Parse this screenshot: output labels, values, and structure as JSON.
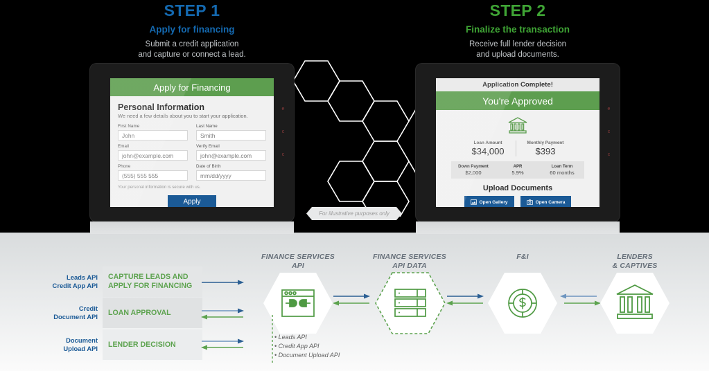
{
  "colors": {
    "blue": "#1469b0",
    "green": "#3fa535",
    "header_green": "#5d9e4f",
    "button_blue": "#1b5a96",
    "gray_text": "#67707a"
  },
  "steps": {
    "left": {
      "title": "STEP 1",
      "subtitle": "Apply for financing",
      "description_line1": "Submit a credit application",
      "description_line2": "and capture or connect a lead."
    },
    "right": {
      "title": "STEP 2",
      "subtitle": "Finalize the transaction",
      "description_line1": "Receive full lender decision",
      "description_line2": "and upload documents."
    }
  },
  "form_screen": {
    "header": "Apply for Financing",
    "section_title": "Personal Information",
    "section_note": "We need a few details about you to start your application.",
    "fields": [
      {
        "label": "First Name",
        "value": "John"
      },
      {
        "label": "Last Name",
        "value": "Smith"
      },
      {
        "label": "Email",
        "value": "john@example.com"
      },
      {
        "label": "Verify Email",
        "value": "john@example.com"
      },
      {
        "label": "Phone",
        "value": "(555) 555 555"
      },
      {
        "label": "Date of Birth",
        "value": "mm/dd/yyyy"
      }
    ],
    "secure_note": "Your personal information is secure with us.",
    "submit_label": "Apply"
  },
  "approved_screen": {
    "status_bar": "Application Complete!",
    "banner": "You're Approved",
    "bank_icon": "bank-icon",
    "summary": [
      {
        "caption": "Loan Amount",
        "value": "$34,000"
      },
      {
        "caption": "Monthly Payment",
        "value": "$393"
      }
    ],
    "terms": [
      {
        "caption": "Down Payment",
        "value": "$2,000"
      },
      {
        "caption": "APR",
        "value": "5.9%"
      },
      {
        "caption": "Loan Term",
        "value": "60 months"
      }
    ],
    "upload_title": "Upload Documents",
    "upload_buttons": [
      {
        "label": "Open Gallery",
        "icon": "gallery-icon"
      },
      {
        "label": "Open Camera",
        "icon": "camera-icon"
      }
    ]
  },
  "illustrative_caption": "For illustrative purposes only",
  "flow": {
    "rows": [
      {
        "api_line1": "Leads API",
        "api_line2": "Credit App API",
        "action_line1": "CAPTURE LEADS AND",
        "action_line2": "APPLY FOR FINANCING"
      },
      {
        "api_line1": "Credit",
        "api_line2": "Document API",
        "action_line1": "LOAN APPROVAL",
        "action_line2": ""
      },
      {
        "api_line1": "Document",
        "api_line2": "Upload API",
        "action_line1": "LENDER DECISION",
        "action_line2": ""
      }
    ],
    "nodes": [
      {
        "label_line1": "FINANCE SERVICES",
        "label_line2": "API",
        "icon": "api-connector-icon"
      },
      {
        "label_line1": "FINANCE SERVICES",
        "label_line2": "API DATA",
        "icon": "database-icon"
      },
      {
        "label_line1": "F&I",
        "label_line2": "",
        "icon": "dollar-coin-icon"
      },
      {
        "label_line1": "LENDERS",
        "label_line2": "& CAPTIVES",
        "icon": "bank-columns-icon"
      }
    ],
    "bullets": [
      "Leads API",
      "Credit App API",
      "Document Upload API"
    ]
  }
}
